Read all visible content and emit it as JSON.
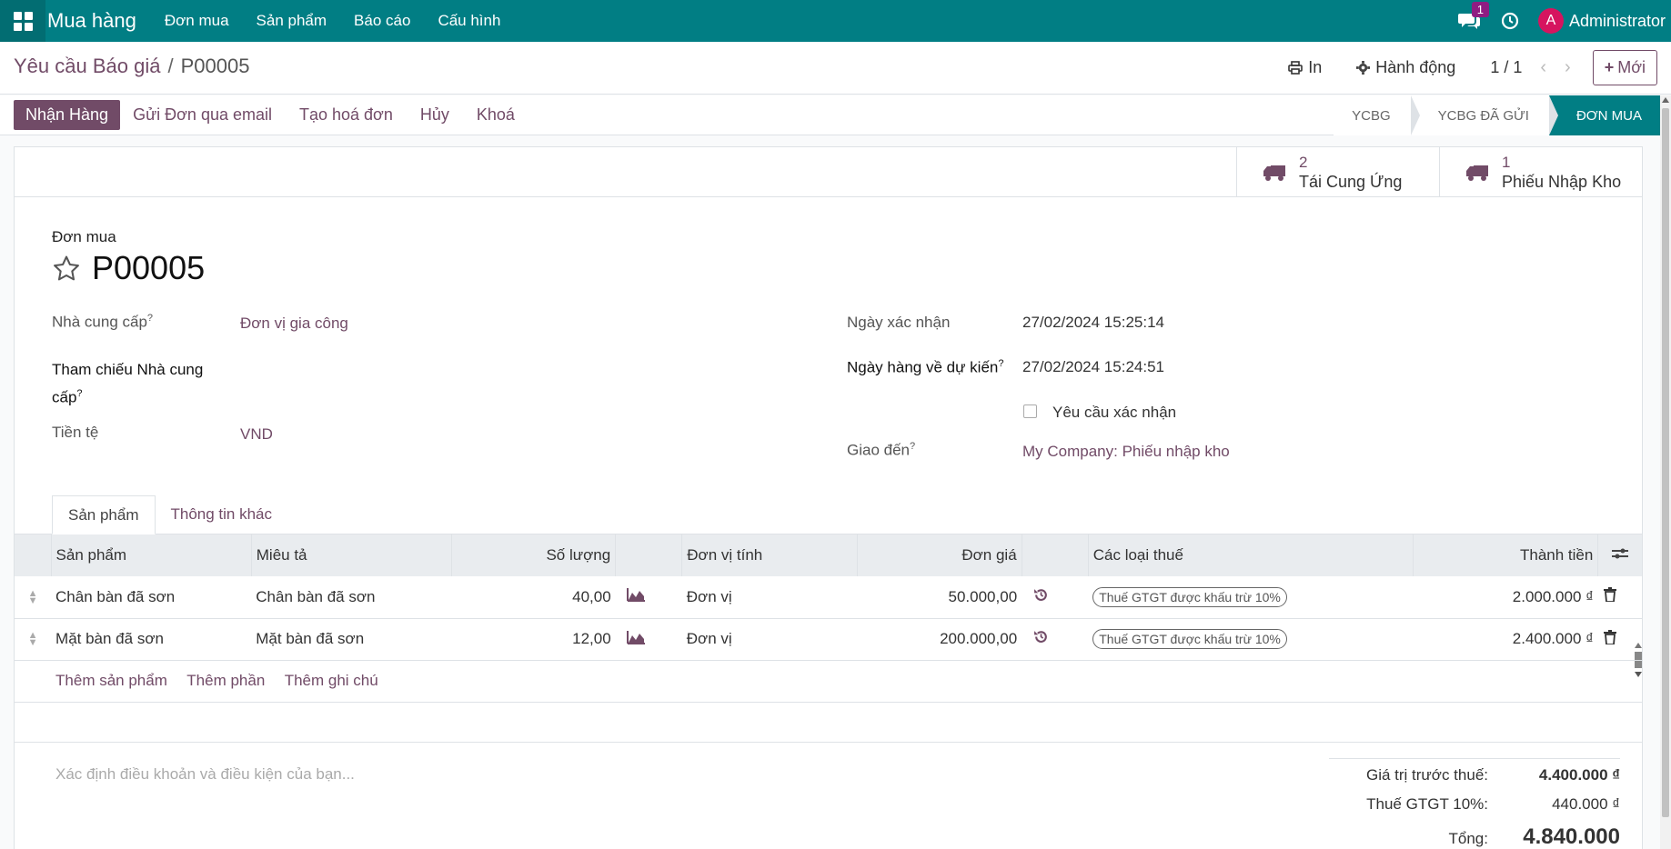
{
  "navbar": {
    "app_name": "Mua hàng",
    "menu": [
      "Đơn mua",
      "Sản phẩm",
      "Báo cáo",
      "Cấu hình"
    ],
    "chat_count": "1",
    "user_initial": "A",
    "user_name": "Administrator",
    "color": "#017e84"
  },
  "breadcrumb": {
    "parent": "Yêu cầu Báo giá",
    "separator": "/",
    "current": "P00005"
  },
  "control": {
    "print_label": "In",
    "action_label": "Hành động",
    "pager": "1 / 1",
    "new_label": "Mới"
  },
  "statusbar": {
    "primary_button": "Nhận Hàng",
    "buttons": [
      "Gửi Đơn qua email",
      "Tạo hoá đơn",
      "Hủy",
      "Khoá"
    ],
    "stages": [
      "YCBG",
      "YCBG ĐÃ GỬI",
      "ĐƠN MUA"
    ],
    "active_stage": "ĐƠN MUA"
  },
  "smart_buttons": [
    {
      "value": "2",
      "label": "Tái Cung Ứng",
      "icon": "truck-icon"
    },
    {
      "value": "1",
      "label": "Phiếu Nhập Kho",
      "icon": "truck-icon"
    }
  ],
  "form": {
    "title_label": "Đơn mua",
    "title": "P00005",
    "vendor_label": "Nhà cung cấp",
    "vendor": "Đơn vị gia công",
    "vendor_ref_label_1": "Tham chiếu Nhà cung",
    "vendor_ref_label_2": "cấp",
    "currency_label": "Tiền tệ",
    "currency": "VND",
    "confirm_date_label": "Ngày xác nhận",
    "confirm_date": "27/02/2024 15:25:14",
    "expected_date_label": "Ngày hàng về dự kiến",
    "expected_date": "27/02/2024 15:24:51",
    "ask_confirm_label": "Yêu cầu xác nhận",
    "deliver_to_label": "Giao đến",
    "deliver_to": "My Company: Phiếu nhập kho",
    "help_mark": "?"
  },
  "tabs": [
    "Sản phẩm",
    "Thông tin khác"
  ],
  "lines": {
    "headers": [
      "Sản phẩm",
      "Miêu tả",
      "Số lượng",
      "Đơn vị tính",
      "Đơn giá",
      "Các loại thuế",
      "Thành tiền"
    ],
    "rows": [
      {
        "product": "Chân bàn đã sơn",
        "description": "Chân bàn đã sơn",
        "qty": "40,00",
        "uom": "Đơn vị",
        "price": "50.000,00",
        "tax": "Thuế GTGT được khấu trừ 10%",
        "subtotal": "2.000.000 ₫"
      },
      {
        "product": "Mặt bàn đã sơn",
        "description": "Mặt bàn đã sơn",
        "qty": "12,00",
        "uom": "Đơn vị",
        "price": "200.000,00",
        "tax": "Thuế GTGT được khấu trừ 10%",
        "subtotal": "2.400.000 ₫"
      }
    ],
    "add_links": [
      "Thêm sản phẩm",
      "Thêm phần",
      "Thêm ghi chú"
    ]
  },
  "terms_placeholder": "Xác định điều khoản và điều kiện của bạn...",
  "totals": {
    "untaxed_label": "Giá trị trước thuế:",
    "untaxed": "4.400.000 ₫",
    "tax_label": "Thuế GTGT 10%:",
    "tax": "440.000 ₫",
    "total_label": "Tổng:",
    "total": "4.840.000 ₫"
  },
  "colors": {
    "primary": "#714b67",
    "teal": "#017e84"
  }
}
